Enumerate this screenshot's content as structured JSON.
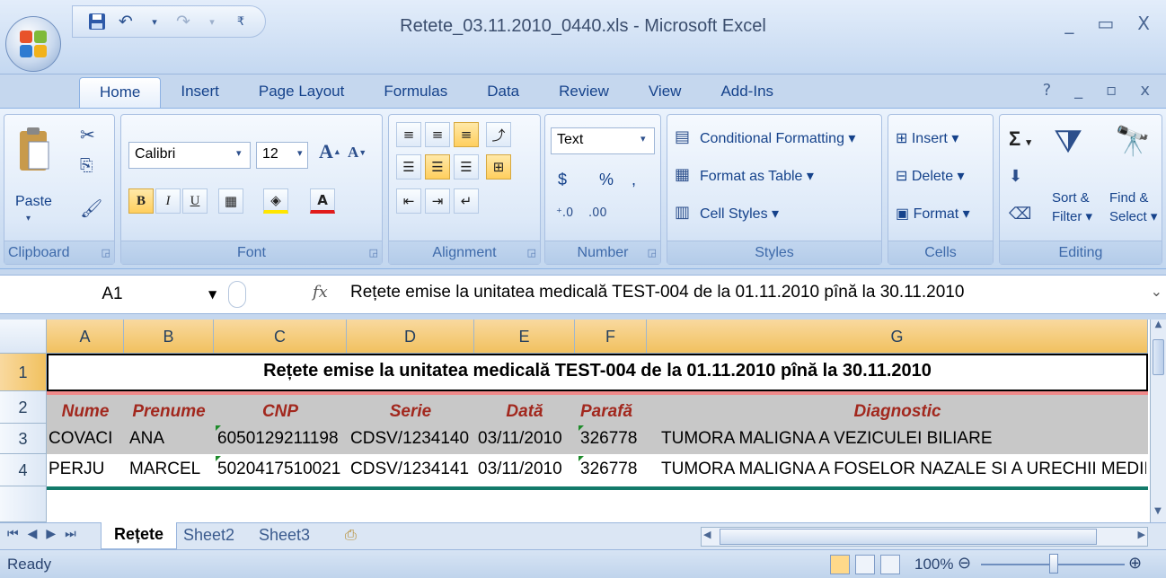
{
  "window": {
    "title": "Retete_03.11.2010_0440.xls - Microsoft Excel"
  },
  "ribbon_tabs": [
    "Home",
    "Insert",
    "Page Layout",
    "Formulas",
    "Data",
    "Review",
    "View",
    "Add-Ins"
  ],
  "ribbon": {
    "clipboard": {
      "label": "Clipboard",
      "paste": "Paste"
    },
    "font": {
      "label": "Font",
      "name": "Calibri",
      "size": "12",
      "bold": "B",
      "italic": "I",
      "underline": "U",
      "grow": "A",
      "shrink": "A"
    },
    "alignment": {
      "label": "Alignment"
    },
    "number": {
      "label": "Number",
      "format": "Text",
      "currency": "$",
      "percent": "%",
      "comma": ","
    },
    "styles": {
      "label": "Styles",
      "conditional": "Conditional Formatting",
      "format_table": "Format as Table",
      "cell_styles": "Cell Styles"
    },
    "cells": {
      "label": "Cells",
      "insert": "Insert",
      "delete": "Delete",
      "format": "Format"
    },
    "editing": {
      "label": "Editing",
      "sigma": "Σ",
      "sort1": "Sort &",
      "sort2": "Filter",
      "find1": "Find &",
      "find2": "Select"
    }
  },
  "formula_bar": {
    "name_box": "A1",
    "fx": "fx",
    "content": "Rețete emise la unitatea medicală TEST-004 de la 01.11.2010 pînă la 30.11.2010"
  },
  "sheet": {
    "columns": [
      "A",
      "B",
      "C",
      "D",
      "E",
      "F",
      "G"
    ],
    "rows": [
      "1",
      "2",
      "3",
      "4"
    ],
    "title": "Rețete emise la unitatea medicală TEST-004 de la 01.11.2010 pînă la 30.11.2010",
    "headers": [
      "Nume",
      "Prenume",
      "CNP",
      "Serie",
      "Dată",
      "Parafă",
      "Diagnostic"
    ],
    "data": [
      [
        "COVACI",
        "ANA",
        "6050129211198",
        "CDSV/1234140",
        "03/11/2010",
        "326778",
        "TUMORA MALIGNA A VEZICULEI BILIARE"
      ],
      [
        "PERJU",
        "MARCEL",
        "5020417510021",
        "CDSV/1234141",
        "03/11/2010",
        "326778",
        "TUMORA MALIGNA A FOSELOR NAZALE SI A URECHII MEDII"
      ]
    ]
  },
  "sheet_tabs": [
    "Rețete",
    "Sheet2",
    "Sheet3"
  ],
  "status": {
    "ready": "Ready",
    "zoom": "100%"
  },
  "colors": {
    "header_text": "#a2281e",
    "selected_header": "#f1c15f",
    "title_underline": "#f08a8a",
    "table_border": "#137a6a"
  }
}
